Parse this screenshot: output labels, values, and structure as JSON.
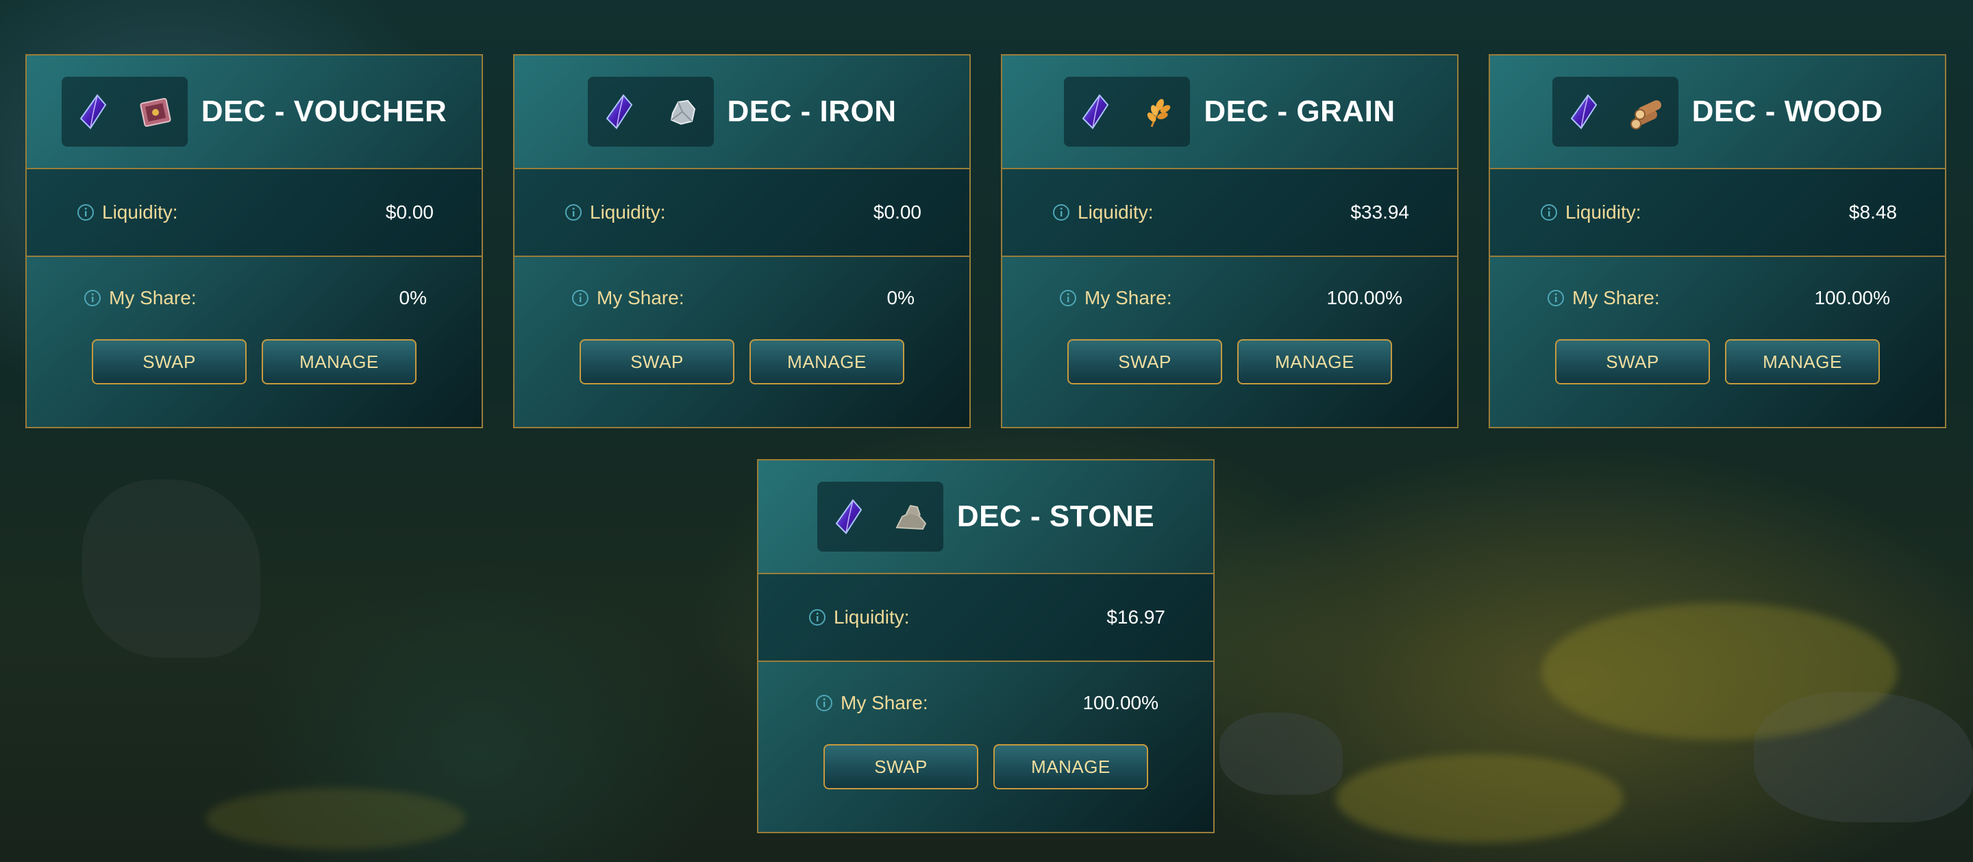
{
  "pools": [
    {
      "title": "DEC - VOUCHER",
      "resource_icon": "voucher-icon",
      "liquidity_label": "Liquidity:",
      "liquidity": "$0.00",
      "share_label": "My Share:",
      "share": "0%",
      "swap_label": "SWAP",
      "manage_label": "MANAGE"
    },
    {
      "title": "DEC - IRON",
      "resource_icon": "iron-icon",
      "liquidity_label": "Liquidity:",
      "liquidity": "$0.00",
      "share_label": "My Share:",
      "share": "0%",
      "swap_label": "SWAP",
      "manage_label": "MANAGE"
    },
    {
      "title": "DEC - GRAIN",
      "resource_icon": "grain-icon",
      "liquidity_label": "Liquidity:",
      "liquidity": "$33.94",
      "share_label": "My Share:",
      "share": "100.00%",
      "swap_label": "SWAP",
      "manage_label": "MANAGE"
    },
    {
      "title": "DEC - WOOD",
      "resource_icon": "wood-icon",
      "liquidity_label": "Liquidity:",
      "liquidity": "$8.48",
      "share_label": "My Share:",
      "share": "100.00%",
      "swap_label": "SWAP",
      "manage_label": "MANAGE"
    },
    {
      "title": "DEC - STONE",
      "resource_icon": "stone-icon",
      "liquidity_label": "Liquidity:",
      "liquidity": "$16.97",
      "share_label": "My Share:",
      "share": "100.00%",
      "swap_label": "SWAP",
      "manage_label": "MANAGE"
    }
  ],
  "base_token_icon": "dec-crystal-icon",
  "colors": {
    "border": "#9a7d3a",
    "label": "#f0d998",
    "accent": "#c69a3e"
  }
}
